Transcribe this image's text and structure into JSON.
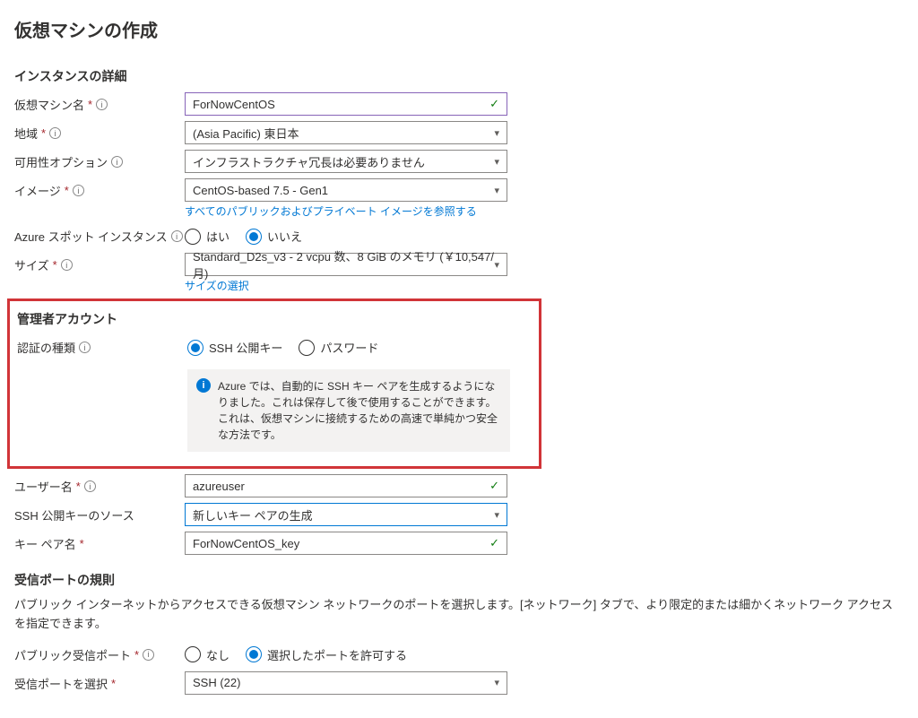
{
  "page_title": "仮想マシンの作成",
  "sections": {
    "instance": {
      "heading": "インスタンスの詳細",
      "vm_name_label": "仮想マシン名",
      "vm_name_value": "ForNowCentOS",
      "region_label": "地域",
      "region_value": "(Asia Pacific) 東日本",
      "availability_label": "可用性オプション",
      "availability_value": "インフラストラクチャ冗長は必要ありません",
      "image_label": "イメージ",
      "image_value": "CentOS-based 7.5 - Gen1",
      "image_link": "すべてのパブリックおよびプライベート イメージを参照する",
      "spot_label": "Azure スポット インスタンス",
      "spot_yes": "はい",
      "spot_no": "いいえ",
      "size_label": "サイズ",
      "size_value": "Standard_D2s_v3 - 2 vcpu 数、8 GiB のメモリ (￥10,547/月)",
      "size_link": "サイズの選択"
    },
    "admin": {
      "heading": "管理者アカウント",
      "auth_type_label": "認証の種類",
      "auth_ssh": "SSH 公開キー",
      "auth_password": "パスワード",
      "info_text": "Azure では、自動的に SSH キー ペアを生成するようになりました。これは保存して後で使用することができます。これは、仮想マシンに接続するための高速で単純かつ安全な方法です。",
      "username_label": "ユーザー名",
      "username_value": "azureuser",
      "ssh_source_label": "SSH 公開キーのソース",
      "ssh_source_value": "新しいキー ペアの生成",
      "keypair_label": "キー ペア名",
      "keypair_value": "ForNowCentOS_key"
    },
    "ports": {
      "heading": "受信ポートの規則",
      "help": "パブリック インターネットからアクセスできる仮想マシン ネットワークのポートを選択します。[ネットワーク] タブで、より限定的または細かくネットワーク アクセスを指定できます。",
      "public_ports_label": "パブリック受信ポート",
      "none": "なし",
      "allow": "選択したポートを許可する",
      "select_ports_label": "受信ポートを選択",
      "select_ports_value": "SSH (22)"
    }
  }
}
